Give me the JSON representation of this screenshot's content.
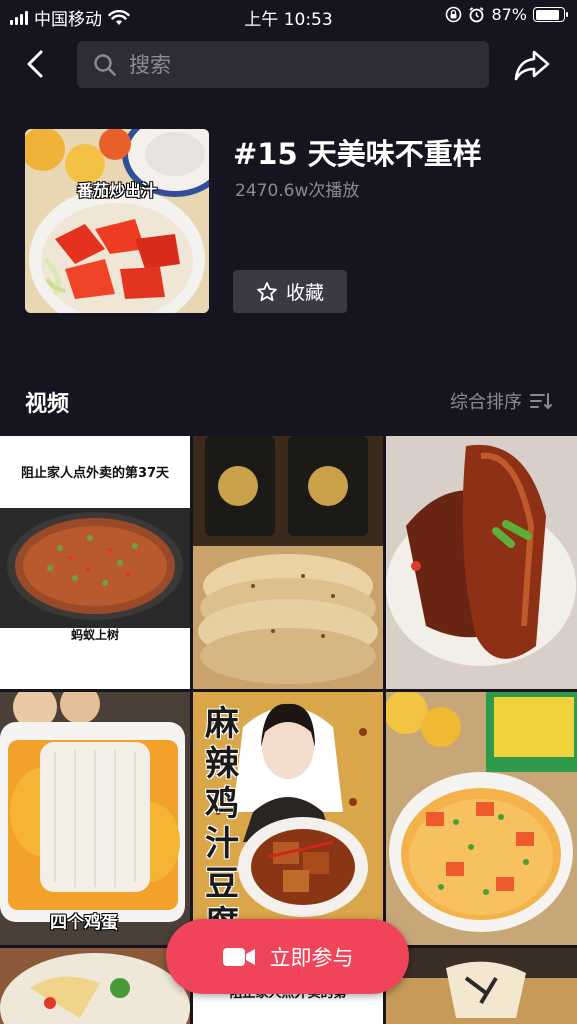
{
  "status_bar": {
    "carrier": "中国移动",
    "time": "上午 10:53",
    "battery": "87%",
    "battery_level": 0.87
  },
  "nav": {
    "search_placeholder": "搜索"
  },
  "topic": {
    "cover_caption": "番茄炒出汁",
    "title": "#15 天美味不重样",
    "plays": "2470.6w次播放",
    "favorite_label": "收藏"
  },
  "videos": {
    "section_title": "视频",
    "sort_label": "综合排序",
    "items": [
      {
        "top_text": "阻止家人点外卖的第37天",
        "bottom_text": "蚂蚁上树"
      },
      {
        "top_text": "",
        "bottom_text": ""
      },
      {
        "top_text": "",
        "bottom_text": ""
      },
      {
        "top_text": "",
        "bottom_text": "四个鸡蛋"
      },
      {
        "top_text": "麻辣鸡汁豆腐",
        "bottom_text": ""
      },
      {
        "top_text": "",
        "bottom_text": ""
      },
      {
        "top_text": "",
        "bottom_text": ""
      },
      {
        "top_text": "阻止家人点外卖的第",
        "bottom_text": ""
      },
      {
        "top_text": "",
        "bottom_text": ""
      }
    ]
  },
  "join_button": {
    "label": "立即参与"
  },
  "colors": {
    "background": "#16151f",
    "accent": "#f0445a",
    "search_bg": "#2d2c37"
  }
}
